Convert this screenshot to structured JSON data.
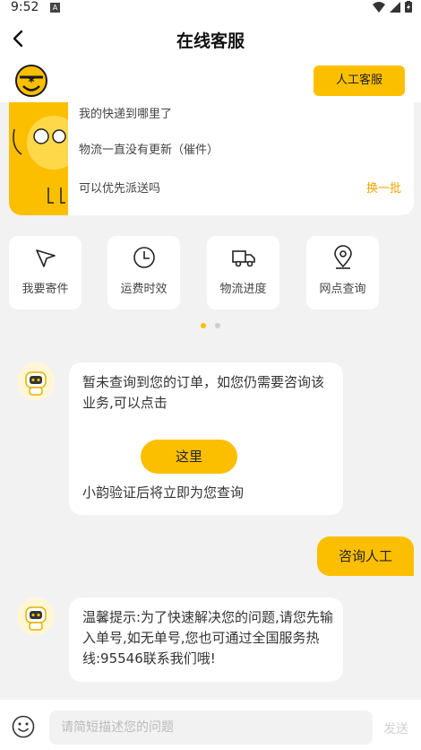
{
  "status": {
    "time": "9:52",
    "notif_glyph": "A"
  },
  "header": {
    "title": "在线客服"
  },
  "brand": {
    "human_service_label": "人工客服"
  },
  "faq": {
    "questions": [
      "我的快递到哪里了",
      "物流一直没有更新（催件）",
      "可以优先派送吗"
    ],
    "refresh_label": "换一批"
  },
  "quick_actions": [
    {
      "label": "我要寄件",
      "icon": "send-arrow-icon"
    },
    {
      "label": "运费时效",
      "icon": "clock-icon"
    },
    {
      "label": "物流进度",
      "icon": "truck-icon"
    },
    {
      "label": "网点查询",
      "icon": "location-pin-icon"
    }
  ],
  "carousel": {
    "pages": 2,
    "active": 0
  },
  "messages": {
    "bot1": {
      "text": "暂未查询到您的订单，如您仍需要咨询该业务,可以点击",
      "button_label": "这里",
      "footer": "小韵验证后将立即为您查询"
    },
    "user1": {
      "text": "咨询人工"
    },
    "bot2": {
      "text": "温馨提示:为了快速解决您的问题,请您先输入单号,如无单号,您也可通过全国服务热线:95546联系我们哦!"
    }
  },
  "composer": {
    "placeholder": "请简短描述您的问题",
    "send_label": "发送"
  },
  "colors": {
    "accent": "#fcbf00",
    "background": "#f2f2f2",
    "link": "#f5a300"
  }
}
